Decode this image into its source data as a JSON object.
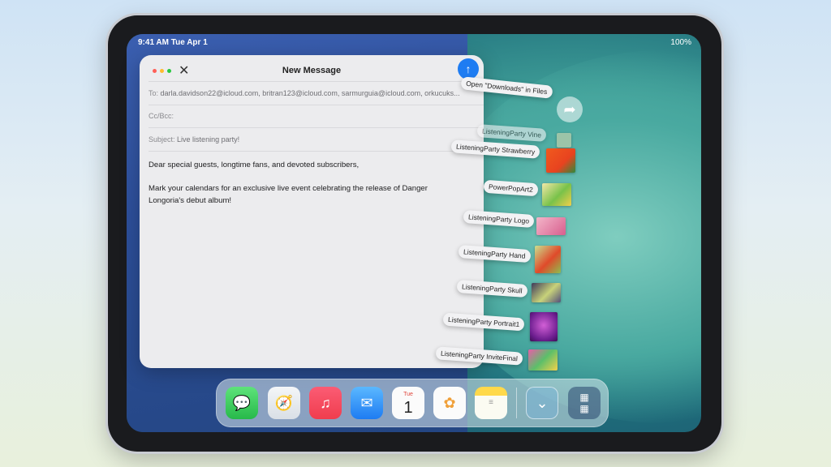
{
  "status": {
    "time": "9:41 AM  Tue Apr 1",
    "battery": "100%"
  },
  "mail": {
    "title": "New Message",
    "to_label": "To:",
    "to_value": "darla.davidson22@icloud.com, britran123@icloud.com, sarmurguia@icloud.com, orkucuks...",
    "cc_label": "Cc/Bcc:",
    "subject_label": "Subject:",
    "subject_value": "Live listening party!",
    "body_p1": "Dear special guests, longtime fans, and devoted subscribers,",
    "body_p2": "Mark your calendars for an exclusive live event celebrating the release of Danger Longoria's debut album!",
    "send_icon": "arrow-up-icon",
    "close_icon": "close-icon"
  },
  "drag": {
    "open_files": "Open \"Downloads\" in Files",
    "items": [
      {
        "label": "ListeningParty Vine"
      },
      {
        "label": "ListeningParty Strawberry"
      },
      {
        "label": "PowerPopArt2"
      },
      {
        "label": "ListeningParty Logo"
      },
      {
        "label": "ListeningParty Hand"
      },
      {
        "label": "ListeningParty Skull"
      },
      {
        "label": "ListeningParty Portrait1"
      },
      {
        "label": "ListeningParty InviteFinal"
      }
    ]
  },
  "dock": {
    "calendar_day": "Tue",
    "calendar_date": "1",
    "apps": [
      "messages-icon",
      "safari-icon",
      "music-icon",
      "mail-icon",
      "calendar-icon",
      "photos-icon",
      "notes-icon",
      "downloads-icon",
      "app-library-icon"
    ]
  },
  "colors": {
    "accent": "#1e7cf2",
    "music": "#f03d4e",
    "messages": "#34c759"
  }
}
